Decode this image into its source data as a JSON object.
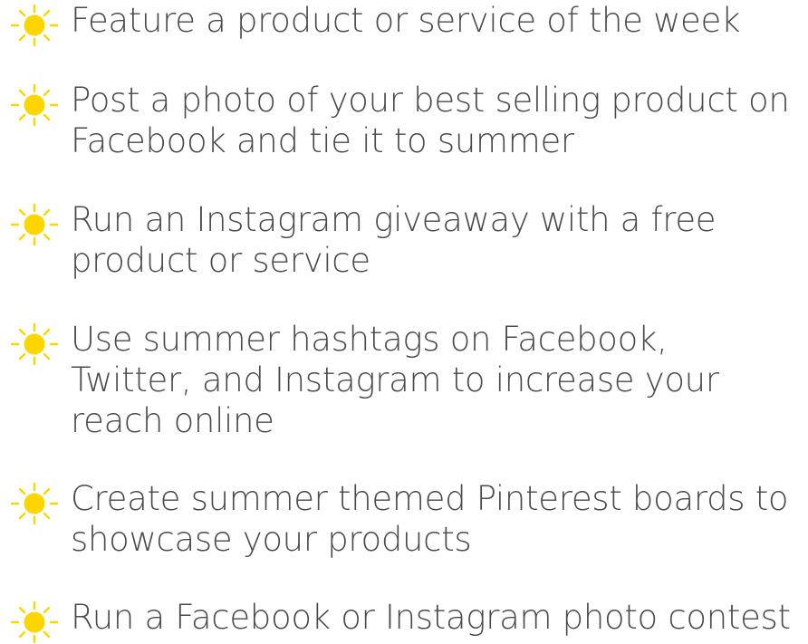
{
  "colors": {
    "text": "#4a4a4a",
    "sun_fill": "#ffd500",
    "sun_rays": "#ffd500"
  },
  "icon": "sun-icon",
  "tips": [
    {
      "text": "Feature a product or service of the week"
    },
    {
      "text": "Post a photo of your best selling product on\nFacebook and tie it to summer"
    },
    {
      "text": "Run an Instagram giveaway with a free\nproduct or service"
    },
    {
      "text": "Use summer hashtags on Facebook,\nTwitter, and Instagram to increase your\nreach online"
    },
    {
      "text": "Create summer themed Pinterest boards to\nshowcase your products"
    },
    {
      "text": "Run a Facebook or Instagram photo contest"
    }
  ]
}
